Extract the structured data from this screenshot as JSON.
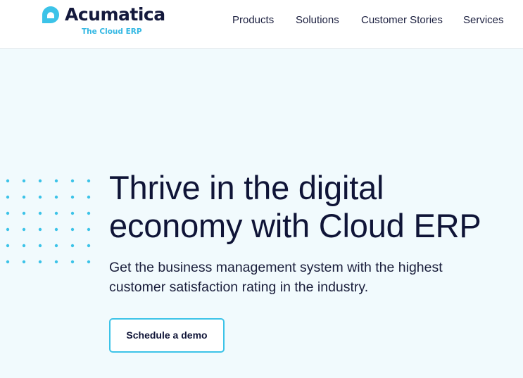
{
  "header": {
    "logo": {
      "brand": "Acumatica",
      "tagline": "The Cloud ERP",
      "icon": "acumatica-logo-icon"
    },
    "nav": [
      {
        "label": "Products"
      },
      {
        "label": "Solutions"
      },
      {
        "label": "Customer Stories"
      },
      {
        "label": "Services"
      }
    ]
  },
  "hero": {
    "title_line1": "Thrive in the digital",
    "title_line2": "economy with Cloud ERP",
    "subtitle_line1": "Get the business management system with the highest",
    "subtitle_line2": "customer satisfaction rating in the industry.",
    "cta_label": "Schedule a demo",
    "decoration": "dot-grid-pattern"
  },
  "colors": {
    "brand_dark": "#14193c",
    "brand_accent": "#34b8e3",
    "hero_background": "#f1fafd",
    "header_background": "#ffffff",
    "button_border": "#3cc3e8"
  }
}
